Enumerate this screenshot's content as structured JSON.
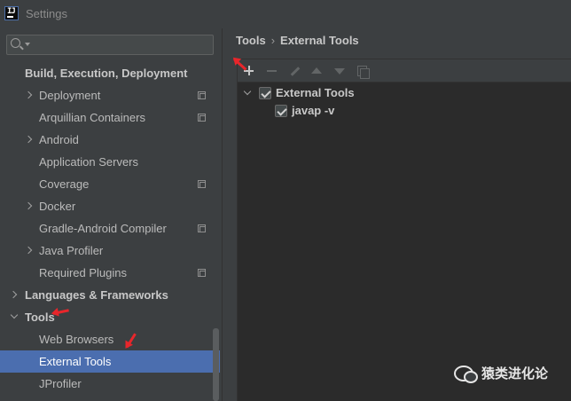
{
  "window": {
    "title": "Settings",
    "app_icon": "intellij-idea-icon"
  },
  "search": {
    "value": "",
    "placeholder": ""
  },
  "sidebar": {
    "items": [
      {
        "label": "Build, Execution, Deployment",
        "bold": true,
        "expand": "none",
        "project_icon": false
      },
      {
        "label": "Deployment",
        "expand": "collapsed",
        "project_icon": true
      },
      {
        "label": "Arquillian Containers",
        "expand": "none",
        "project_icon": true
      },
      {
        "label": "Android",
        "expand": "collapsed",
        "project_icon": false
      },
      {
        "label": "Application Servers",
        "expand": "none",
        "project_icon": false
      },
      {
        "label": "Coverage",
        "expand": "none",
        "project_icon": true
      },
      {
        "label": "Docker",
        "expand": "collapsed",
        "project_icon": false
      },
      {
        "label": "Gradle-Android Compiler",
        "expand": "none",
        "project_icon": true
      },
      {
        "label": "Java Profiler",
        "expand": "collapsed",
        "project_icon": false
      },
      {
        "label": "Required Plugins",
        "expand": "none",
        "project_icon": true
      },
      {
        "label": "Languages & Frameworks",
        "bold": true,
        "expand": "collapsed",
        "project_icon": false
      },
      {
        "label": "Tools",
        "bold": true,
        "expand": "expanded",
        "project_icon": false
      },
      {
        "label": "Web Browsers",
        "expand": "none",
        "project_icon": false
      },
      {
        "label": "External Tools",
        "expand": "none",
        "project_icon": false,
        "selected": true
      },
      {
        "label": "JProfiler",
        "expand": "none",
        "project_icon": false
      }
    ]
  },
  "breadcrumb": {
    "parent": "Tools",
    "separator": "›",
    "current": "External Tools"
  },
  "toolbar": {
    "buttons": [
      {
        "name": "add-icon",
        "enabled": true
      },
      {
        "name": "remove-icon",
        "enabled": false
      },
      {
        "name": "edit-icon",
        "enabled": false
      },
      {
        "name": "move-up-icon",
        "enabled": false
      },
      {
        "name": "move-down-icon",
        "enabled": false
      },
      {
        "name": "copy-icon",
        "enabled": false
      }
    ]
  },
  "tools_tree": {
    "group": {
      "label": "External Tools",
      "checked": true,
      "expanded": true
    },
    "items": [
      {
        "label": "javap -v",
        "checked": true
      }
    ]
  },
  "annotations": {
    "arrow_color": "#e8262b"
  },
  "watermark": {
    "text": "猿类进化论",
    "icon": "wechat-icon"
  },
  "colors": {
    "selection": "#4b6eaf",
    "background": "#3c3f41",
    "panel": "#2b2b2b"
  }
}
